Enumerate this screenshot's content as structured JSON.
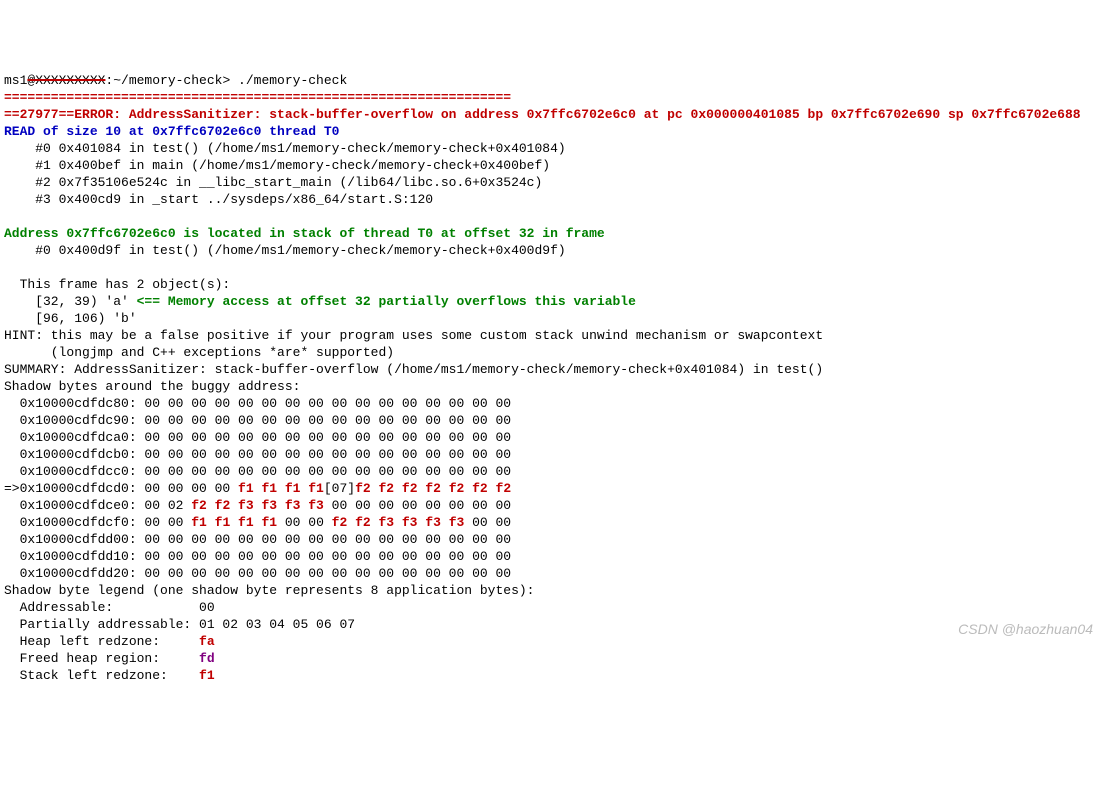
{
  "prompt": {
    "user_prefix": "ms1",
    "hostname_redacted": "@XXXXXXXXX",
    "path": ":~/memory-check> ",
    "command": "./memory-check",
    "separator": "================================================================="
  },
  "error_line": "==27977==ERROR: AddressSanitizer: stack-buffer-overflow on address 0x7ffc6702e6c0 at pc 0x000000401085 bp 0x7ffc6702e690 sp 0x7ffc6702e688",
  "read_line": "READ of size 10 at 0x7ffc6702e6c0 thread T0",
  "stack1": [
    "    #0 0x401084 in test() (/home/ms1/memory-check/memory-check+0x401084)",
    "    #1 0x400bef in main (/home/ms1/memory-check/memory-check+0x400bef)",
    "    #2 0x7f35106e524c in __libc_start_main (/lib64/libc.so.6+0x3524c)",
    "    #3 0x400cd9 in _start ../sysdeps/x86_64/start.S:120"
  ],
  "address_line": "Address 0x7ffc6702e6c0 is located in stack of thread T0 at offset 32 in frame",
  "stack2": "    #0 0x400d9f in test() (/home/ms1/memory-check/memory-check+0x400d9f)",
  "frame_intro": "  This frame has 2 object(s):",
  "frame_a_prefix": "    [32, 39) 'a' ",
  "frame_a_hint": "<== Memory access at offset 32 partially overflows this variable",
  "frame_b": "    [96, 106) 'b'",
  "hint1": "HINT: this may be a false positive if your program uses some custom stack unwind mechanism or swapcontext",
  "hint2": "      (longjmp and C++ exceptions *are* supported)",
  "summary": "SUMMARY: AddressSanitizer: stack-buffer-overflow (/home/ms1/memory-check/memory-check+0x401084) in test()",
  "shadow_header": "Shadow bytes around the buggy address:",
  "shadow_rows": {
    "r0": "  0x10000cdfdc80: 00 00 00 00 00 00 00 00 00 00 00 00 00 00 00 00",
    "r1": "  0x10000cdfdc90: 00 00 00 00 00 00 00 00 00 00 00 00 00 00 00 00",
    "r2": "  0x10000cdfdca0: 00 00 00 00 00 00 00 00 00 00 00 00 00 00 00 00",
    "r3": "  0x10000cdfdcb0: 00 00 00 00 00 00 00 00 00 00 00 00 00 00 00 00",
    "r4": "  0x10000cdfdcc0: 00 00 00 00 00 00 00 00 00 00 00 00 00 00 00 00"
  },
  "shadow_ptr": {
    "prefix": "=>0x10000cdfdcd0: 00 00 00 00 ",
    "f1": "f1 f1 f1 f1",
    "mid": "[07]",
    "f2": "f2 f2 f2 f2 f2 f2 f2"
  },
  "shadow_e0": {
    "prefix": "  0x10000cdfdce0: 00 02 ",
    "red": "f2 f2 f3 f3 f3 f3",
    "suffix": " 00 00 00 00 00 00 00 00"
  },
  "shadow_f0": {
    "prefix": "  0x10000cdfdcf0: 00 00 ",
    "red1": "f1 f1 f1 f1",
    "mid": " 00 00 ",
    "red2": "f2 f2 f3 f3 f3 f3",
    "suffix": " 00 00"
  },
  "shadow_tail": {
    "t0": "  0x10000cdfdd00: 00 00 00 00 00 00 00 00 00 00 00 00 00 00 00 00",
    "t1": "  0x10000cdfdd10: 00 00 00 00 00 00 00 00 00 00 00 00 00 00 00 00",
    "t2": "  0x10000cdfdd20: 00 00 00 00 00 00 00 00 00 00 00 00 00 00 00 00"
  },
  "legend_header": "Shadow byte legend (one shadow byte represents 8 application bytes):",
  "legend": {
    "addressable_label": "  Addressable:           ",
    "addressable_val": "00",
    "partial": "  Partially addressable: 01 02 03 04 05 06 07 ",
    "heap_left_label": "  Heap left redzone:     ",
    "heap_left_val": "fa",
    "freed_label": "  Freed heap region:     ",
    "freed_val": "fd",
    "stack_left_label": "  Stack left redzone:    ",
    "stack_left_val": "f1"
  },
  "watermark": "CSDN @haozhuan04"
}
